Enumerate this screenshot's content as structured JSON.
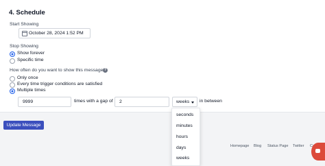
{
  "section_title": "4. Schedule",
  "start_showing": {
    "label": "Start Showing",
    "date_value": "October 28, 2024 1:52 PM"
  },
  "stop_showing": {
    "label": "Stop Showing",
    "options": [
      "Show forever",
      "Specific time"
    ],
    "selected": "Show forever"
  },
  "frequency": {
    "question": "How often do you want to show this message?",
    "options": [
      "Only once",
      "Every time trigger conditions are satisfied",
      "Multiple times"
    ],
    "selected": "Multiple times",
    "times_value": "9999",
    "times_text": "times with a gap of",
    "gap_value": "2",
    "unit_selected": "weeks",
    "suffix_text": "in between",
    "unit_options": [
      "seconds",
      "minutes",
      "hours",
      "days",
      "weeks"
    ]
  },
  "update_button": "Update Message",
  "footer": {
    "links": [
      "Homepage",
      "Blog",
      "Status Page",
      "Twitter",
      "Careers"
    ]
  },
  "colors": {
    "primary_button": "#3b4fbd",
    "radio_selected": "#2563eb",
    "chat_widget": "#dc4a3a"
  },
  "icons": {
    "date": "calendar-icon",
    "help": "question-circle-icon",
    "chat": "chat-icon"
  }
}
